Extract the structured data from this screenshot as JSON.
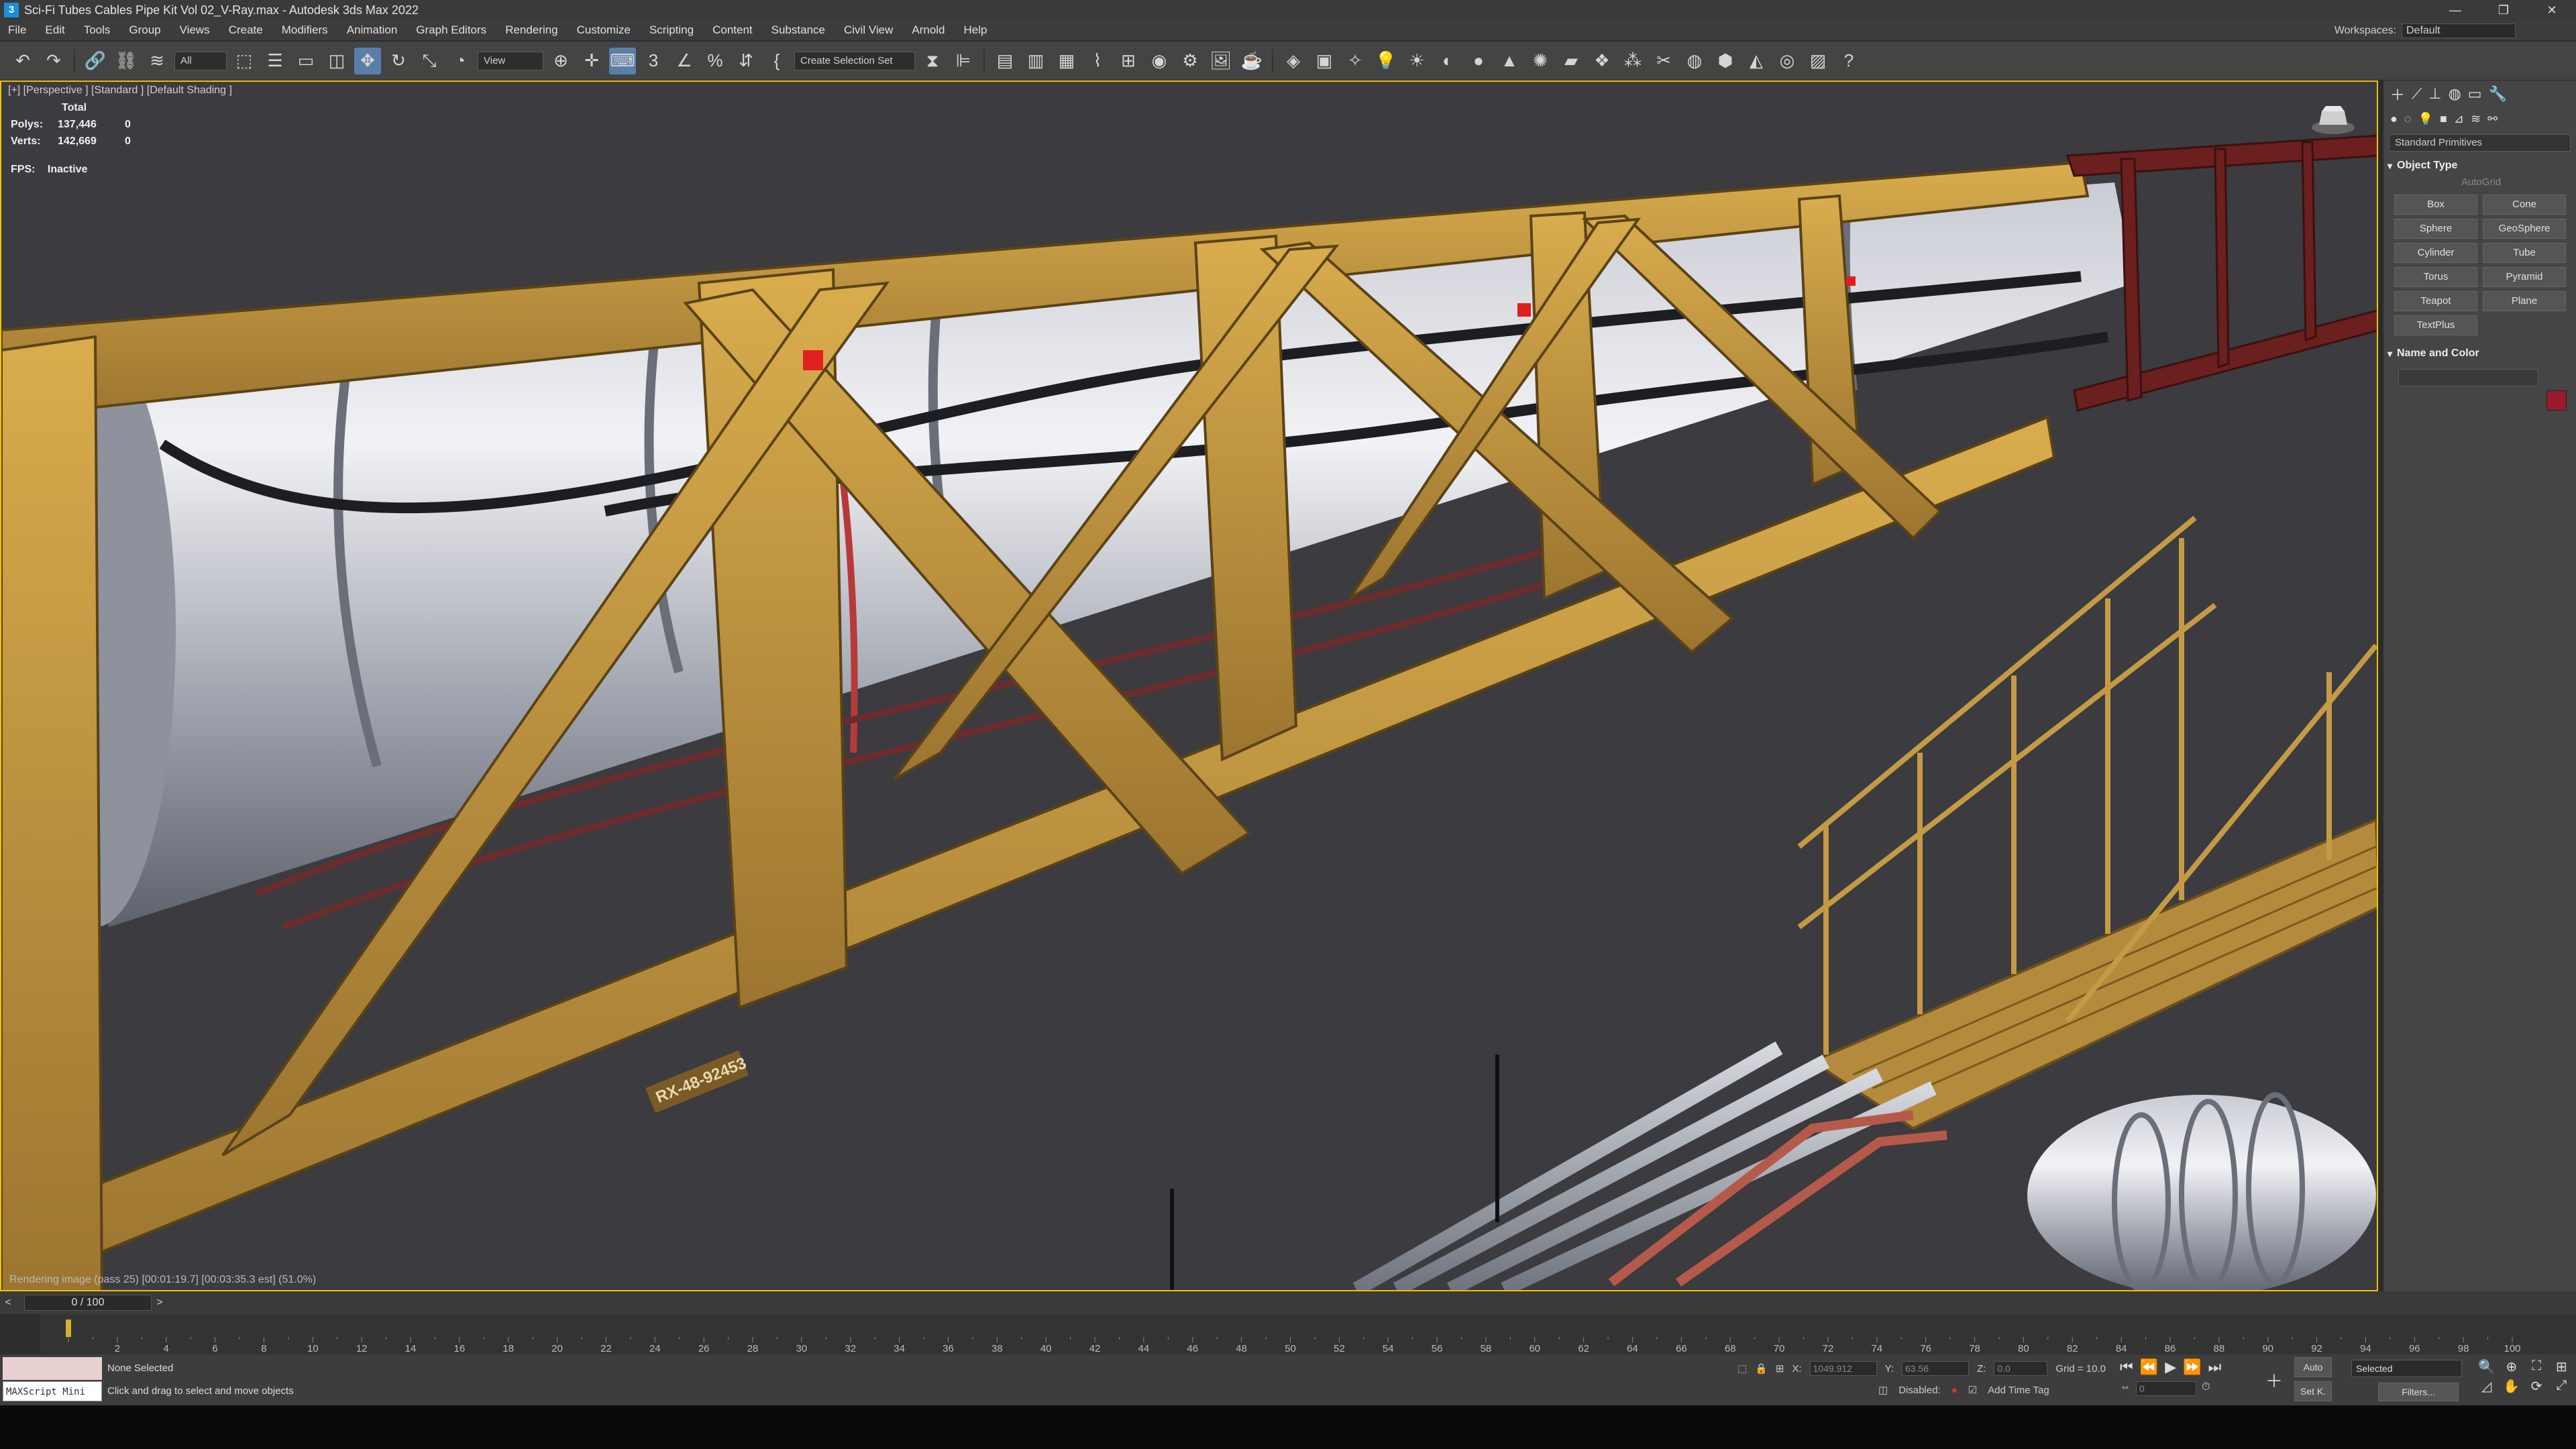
{
  "window": {
    "title": "Sci-Fi Tubes Cables Pipe Kit Vol 02_V-Ray.max - Autodesk 3ds Max 2022",
    "icon_letter": "3",
    "controls": [
      "—",
      "❐",
      "✕"
    ]
  },
  "menu": [
    "File",
    "Edit",
    "Tools",
    "Group",
    "Views",
    "Create",
    "Modifiers",
    "Animation",
    "Graph Editors",
    "Rendering",
    "Customize",
    "Scripting",
    "Content",
    "Substance",
    "Civil View",
    "Arnold",
    "Help"
  ],
  "workspace": {
    "label": "Workspaces:",
    "value": "Default"
  },
  "toolbar": {
    "selection_filter": "All",
    "ref_coord": "View",
    "named_selection": "Create Selection Set"
  },
  "viewport": {
    "label": "[+] [Perspective ] [Standard ] [Default Shading ]",
    "stats": {
      "header": "Total",
      "polys_label": "Polys:",
      "polys_total": "137,446",
      "polys_sel": "0",
      "verts_label": "Verts:",
      "verts_total": "142,669",
      "verts_sel": "0"
    },
    "fps_label": "FPS:",
    "fps_value": "Inactive",
    "render_status": "Rendering image (pass 25) [00:01:19.7] [00:03:35.3 est]    (51.0%)",
    "part_label": "RX-48-92453"
  },
  "command_panel": {
    "dropdown": "Standard Primitives",
    "object_type_title": "Object Type",
    "autogrid": "AutoGrid",
    "primitives": [
      "Box",
      "Cone",
      "Sphere",
      "GeoSphere",
      "Cylinder",
      "Tube",
      "Torus",
      "Pyramid",
      "Teapot",
      "Plane",
      "TextPlus"
    ],
    "name_color_title": "Name and Color",
    "object_color": "#9b1a2e"
  },
  "time": {
    "frame_display": "0 / 100",
    "ticks": [
      "2",
      "4",
      "6",
      "8",
      "10",
      "12",
      "14",
      "16",
      "18",
      "20",
      "22",
      "24",
      "26",
      "28",
      "30",
      "32",
      "34",
      "36",
      "38",
      "40",
      "42",
      "44",
      "46",
      "48",
      "50",
      "52",
      "54",
      "56",
      "58",
      "60",
      "62",
      "64",
      "66",
      "68",
      "70",
      "72",
      "74",
      "76",
      "78",
      "80",
      "82",
      "84",
      "86",
      "88",
      "90",
      "92",
      "94",
      "96",
      "98",
      "100"
    ]
  },
  "status": {
    "maxscript": "MAXScript Mini",
    "selection": "None Selected",
    "prompt": "Click and drag to select and move objects",
    "x_label": "X:",
    "x_value": "1049.912",
    "y_label": "Y:",
    "y_value": "63.56",
    "z_label": "Z:",
    "z_value": "0.0",
    "grid": "Grid = 10.0",
    "disabled_label": "Disabled:",
    "add_time_tag": "Add Time Tag",
    "auto_key": "Auto",
    "set_key": "Set K.",
    "key_filter": "Selected",
    "filters": "Filters...",
    "current_frame": "0"
  }
}
